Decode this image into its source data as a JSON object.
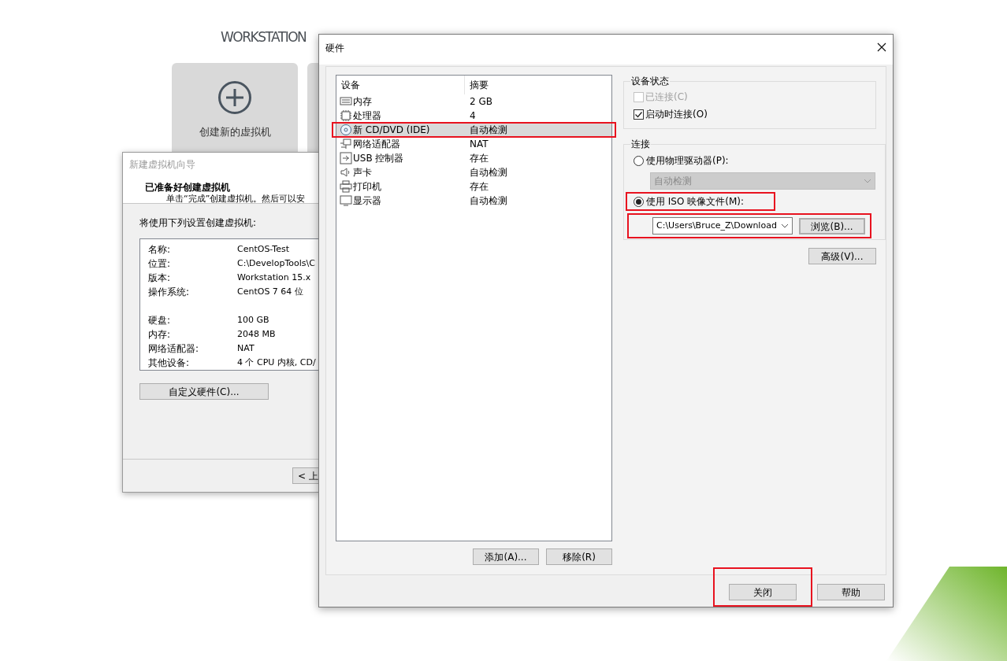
{
  "background": {
    "brand": "WORKSTATION",
    "tiles": [
      {
        "label": "创建新的虚拟机"
      }
    ]
  },
  "wizard": {
    "title": "新建虚拟机向导",
    "heading": "已准备好创建虚拟机",
    "subheading": "单击“完成”创建虚拟机。然后可以安",
    "intro": "将使用下列设置创建虚拟机:",
    "setting_groups": [
      [
        {
          "label": "名称:",
          "value": "CentOS-Test"
        },
        {
          "label": "位置:",
          "value": "C:\\DevelopTools\\C"
        },
        {
          "label": "版本:",
          "value": "Workstation 15.x"
        },
        {
          "label": "操作系统:",
          "value": "CentOS 7 64 位"
        }
      ],
      [
        {
          "label": "硬盘:",
          "value": "100 GB"
        },
        {
          "label": "内存:",
          "value": "2048 MB"
        },
        {
          "label": "网络适配器:",
          "value": "NAT"
        },
        {
          "label": "其他设备:",
          "value": "4 个 CPU 内核, CD/"
        }
      ]
    ],
    "customize_button": "自定义硬件(C)...",
    "back_button": "< 上"
  },
  "hardware": {
    "title": "硬件",
    "columns": [
      "设备",
      "摘要"
    ],
    "devices": [
      {
        "name": "内存",
        "summary": "2 GB",
        "selected": false,
        "highlighted": false
      },
      {
        "name": "处理器",
        "summary": "4",
        "selected": false,
        "highlighted": false
      },
      {
        "name": "新 CD/DVD (IDE)",
        "summary": "自动检测",
        "selected": true,
        "highlighted": true
      },
      {
        "name": "网络适配器",
        "summary": "NAT",
        "selected": false,
        "highlighted": false
      },
      {
        "name": "USB 控制器",
        "summary": "存在",
        "selected": false,
        "highlighted": false
      },
      {
        "name": "声卡",
        "summary": "自动检测",
        "selected": false,
        "highlighted": false
      },
      {
        "name": "打印机",
        "summary": "存在",
        "selected": false,
        "highlighted": false
      },
      {
        "name": "显示器",
        "summary": "自动检测",
        "selected": false,
        "highlighted": false
      }
    ],
    "list_buttons": [
      "添加(A)...",
      "移除(R)"
    ],
    "device_status": {
      "title": "设备状态",
      "options": [
        {
          "label": "已连接(C)",
          "checked": false,
          "disabled": true
        },
        {
          "label": "启动时连接(O)",
          "checked": true,
          "disabled": false
        }
      ]
    },
    "connection": {
      "title": "连接",
      "options": [
        {
          "label": "使用物理驱动器(P):",
          "selected": false,
          "highlighted": false
        },
        {
          "label": "使用 ISO 映像文件(M):",
          "selected": true,
          "highlighted": true
        }
      ],
      "drive_select": {
        "value": "自动检测",
        "disabled": true
      },
      "iso_path": {
        "value": "C:\\Users\\Bruce_Z\\Download",
        "highlighted": true
      },
      "browse_button": "浏览(B)..."
    },
    "advanced_button": "高级(V)...",
    "footer_buttons": [
      {
        "label": "关闭",
        "highlighted": true
      },
      {
        "label": "帮助",
        "highlighted": false
      }
    ]
  }
}
